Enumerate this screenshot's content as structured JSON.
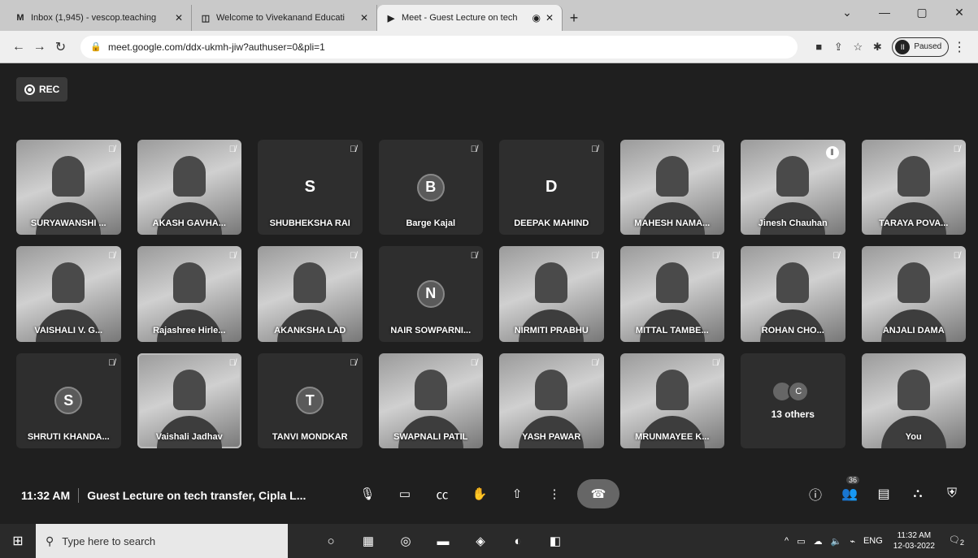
{
  "browser": {
    "tabs": [
      {
        "icon": "M",
        "title": "Inbox (1,945) - vescop.teaching"
      },
      {
        "icon": "◫",
        "title": "Welcome to Vivekanand Educati"
      },
      {
        "icon": "▶",
        "title": "Meet - Guest Lecture on tech",
        "active": true
      }
    ],
    "new_tab": "+",
    "url": "meet.google.com/ddx-ukmh-jiw?authuser=0&pli=1",
    "profile_status": "Paused"
  },
  "meet": {
    "rec_label": "REC",
    "participants": [
      {
        "name": "SURYAWANSHI ...",
        "kind": "video"
      },
      {
        "name": "AKASH GAVHA...",
        "kind": "video"
      },
      {
        "name": "SHUBHEKSHA RAI",
        "kind": "letter",
        "initial": "S"
      },
      {
        "name": "Barge Kajal",
        "kind": "avatar",
        "initial": "B"
      },
      {
        "name": "DEEPAK MAHIND",
        "kind": "letter",
        "initial": "D"
      },
      {
        "name": "MAHESH NAMA...",
        "kind": "video"
      },
      {
        "name": "Jinesh Chauhan",
        "kind": "video",
        "speaking": true
      },
      {
        "name": "TARAYA POVA...",
        "kind": "video"
      },
      {
        "name": "VAISHALI V. G...",
        "kind": "video"
      },
      {
        "name": "Rajashree Hirle...",
        "kind": "video"
      },
      {
        "name": "AKANKSHA LAD",
        "kind": "video"
      },
      {
        "name": "NAIR SOWPARNI...",
        "kind": "avatar",
        "initial": "N"
      },
      {
        "name": "NIRMITI PRABHU",
        "kind": "video"
      },
      {
        "name": "MITTAL TAMBE...",
        "kind": "video"
      },
      {
        "name": "ROHAN CHO...",
        "kind": "video"
      },
      {
        "name": "ANJALI DAMA",
        "kind": "video"
      },
      {
        "name": "SHRUTI KHANDA...",
        "kind": "avatar",
        "initial": "S"
      },
      {
        "name": "Vaishali Jadhav",
        "kind": "video",
        "highlight": true
      },
      {
        "name": "TANVI MONDKAR",
        "kind": "avatar",
        "initial": "T"
      },
      {
        "name": "SWAPNALI PATIL",
        "kind": "video"
      },
      {
        "name": "YASH PAWAR",
        "kind": "video"
      },
      {
        "name": "MRUNMAYEE K...",
        "kind": "video"
      },
      {
        "name": "13 others",
        "kind": "others",
        "initial": "C"
      },
      {
        "name": "You",
        "kind": "video"
      }
    ],
    "time": "11:32 AM",
    "meeting_title": "Guest Lecture on tech transfer, Cipla L...",
    "people_count": "36"
  },
  "taskbar": {
    "search_placeholder": "Type here to search",
    "lang": "ENG",
    "time": "11:32 AM",
    "date": "12-03-2022",
    "notif_count": "2"
  }
}
